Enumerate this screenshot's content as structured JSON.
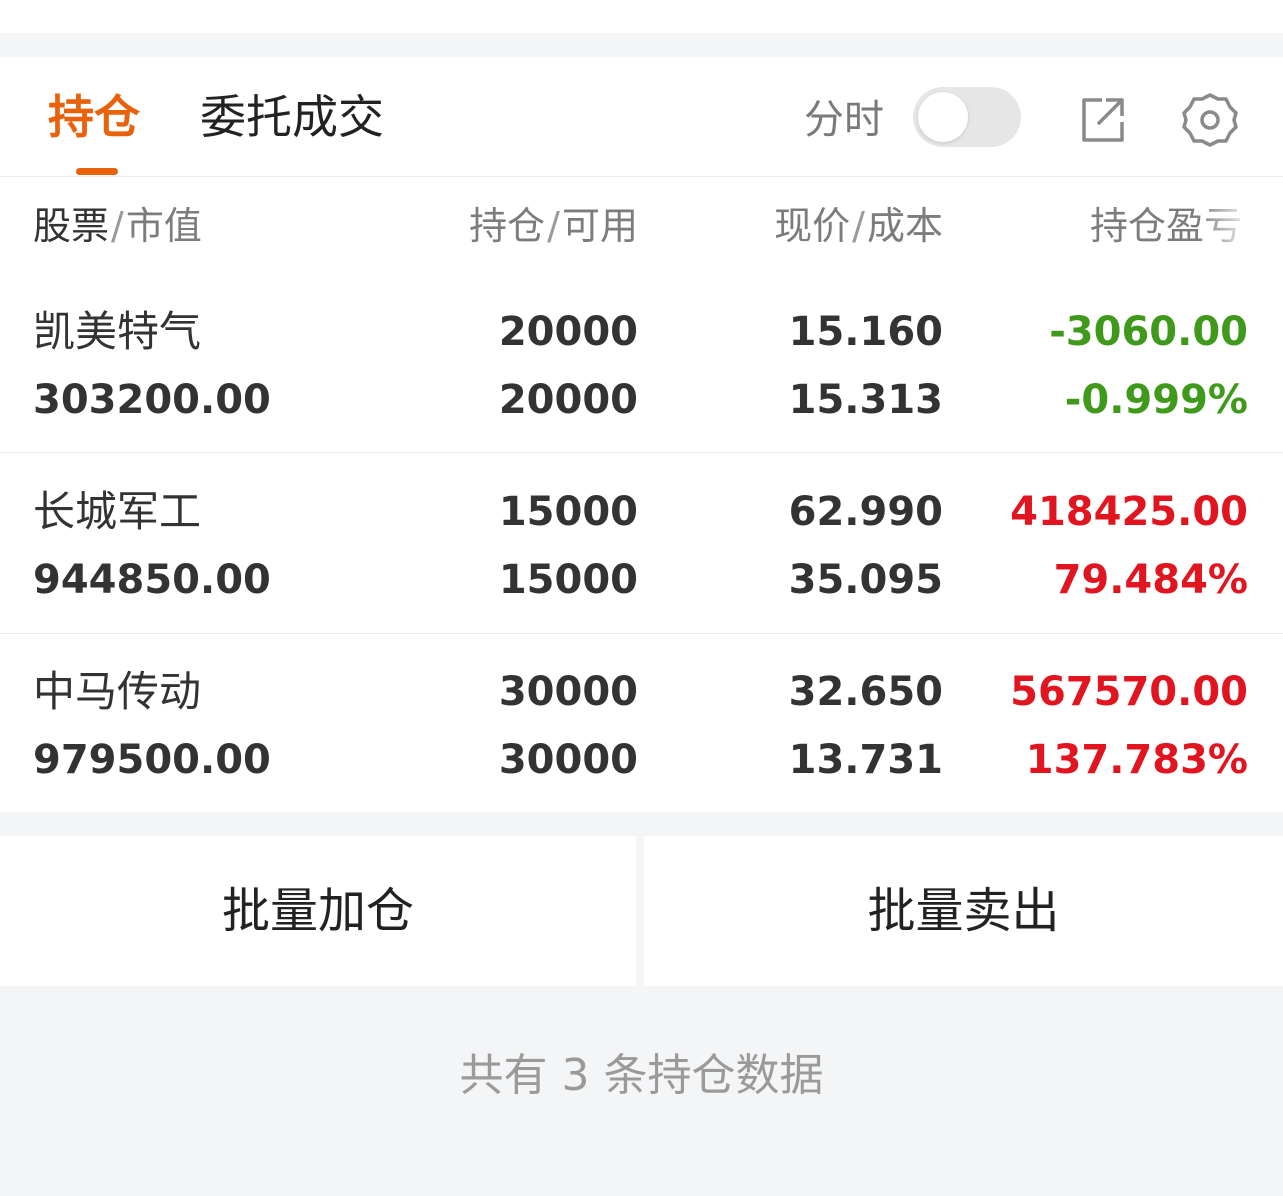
{
  "tabs": {
    "positions": "持仓",
    "orders": "委托成交",
    "timeshare_label": "分时",
    "timeshare_toggle_on": false
  },
  "columns": {
    "stock": "股票",
    "market_value": "市值",
    "position": "持仓",
    "available": "可用",
    "price": "现价",
    "cost": "成本",
    "pnl": "持仓盈亏"
  },
  "holdings": [
    {
      "name": "凯美特气",
      "market_value": "303200.00",
      "position": "20000",
      "available": "20000",
      "price": "15.160",
      "cost": "15.313",
      "pnl_amount": "-3060.00",
      "pnl_percent": "-0.999%",
      "trend": "down"
    },
    {
      "name": "长城军工",
      "market_value": "944850.00",
      "position": "15000",
      "available": "15000",
      "price": "62.990",
      "cost": "35.095",
      "pnl_amount": "418425.00",
      "pnl_percent": "79.484%",
      "trend": "up"
    },
    {
      "name": "中马传动",
      "market_value": "979500.00",
      "position": "30000",
      "available": "30000",
      "price": "32.650",
      "cost": "13.731",
      "pnl_amount": "567570.00",
      "pnl_percent": "137.783%",
      "trend": "up"
    }
  ],
  "actions": {
    "batch_add": "批量加仓",
    "batch_sell": "批量卖出"
  },
  "footer": {
    "summary": "共有 3 条持仓数据"
  },
  "icons": {
    "share": "external-link-icon",
    "settings": "gear-icon"
  },
  "colors": {
    "accent": "#e8620c",
    "gain": "#e0151f",
    "loss": "#3f9a1b"
  }
}
